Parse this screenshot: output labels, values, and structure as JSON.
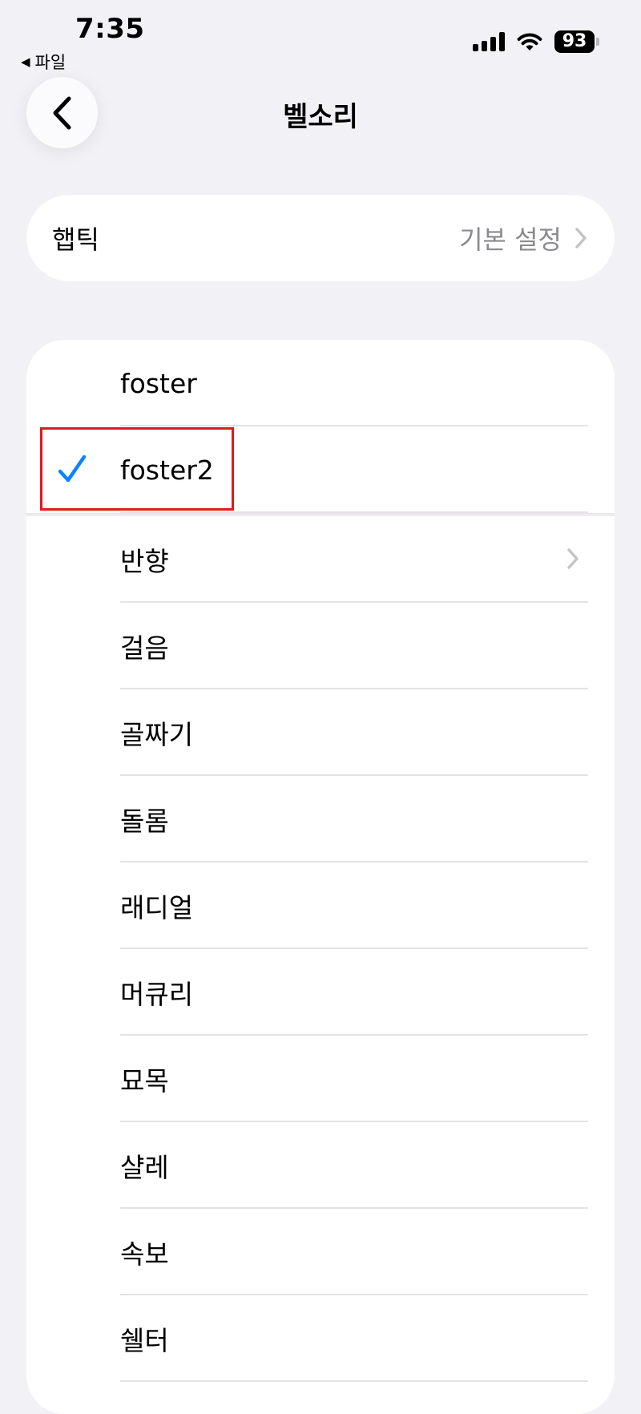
{
  "status_bar": {
    "time": "7:35",
    "back_app_label": "파일",
    "battery_level": "93",
    "icons": [
      "cellular-signal-icon",
      "wifi-icon",
      "battery-icon"
    ]
  },
  "nav": {
    "title": "벨소리",
    "back_icon": "chevron-left-icon"
  },
  "haptic": {
    "label": "햅틱",
    "value": "기본 설정"
  },
  "ringtones": {
    "custom": [
      {
        "label": "foster",
        "selected": false
      },
      {
        "label": "foster2",
        "selected": true
      }
    ],
    "builtin": [
      {
        "label": "반향",
        "has_chevron": true
      },
      {
        "label": "걸음"
      },
      {
        "label": "골짜기"
      },
      {
        "label": "돌롬"
      },
      {
        "label": "래디얼"
      },
      {
        "label": "머큐리"
      },
      {
        "label": "묘목"
      },
      {
        "label": "샬레"
      },
      {
        "label": "속보"
      },
      {
        "label": "쉘터"
      }
    ]
  },
  "colors": {
    "accent": "#0a84ff",
    "background": "#f2f1f6",
    "highlight_box": "#e01a1a"
  }
}
